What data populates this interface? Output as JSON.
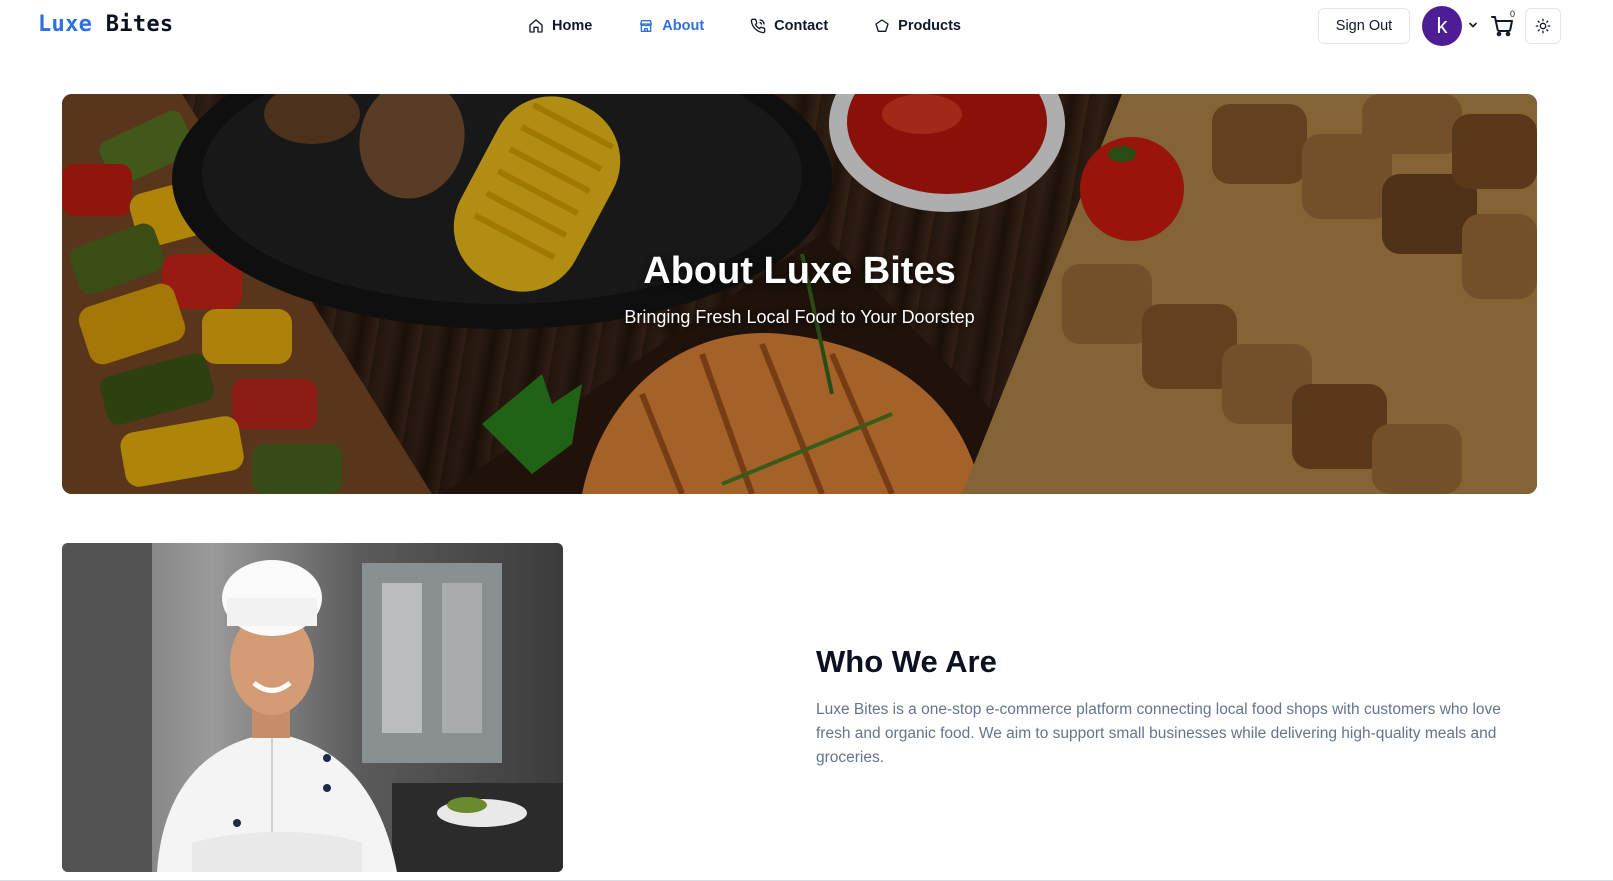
{
  "brand": {
    "part1": "Luxe",
    "part2": "Bites",
    "accent_color": "#2f6fe0"
  },
  "nav": {
    "items": [
      {
        "label": "Home",
        "icon": "home-icon",
        "active": false
      },
      {
        "label": "About",
        "icon": "store-icon",
        "active": true
      },
      {
        "label": "Contact",
        "icon": "phone-icon",
        "active": false
      },
      {
        "label": "Products",
        "icon": "package-icon",
        "active": false
      }
    ]
  },
  "header": {
    "sign_out_label": "Sign Out",
    "avatar_initial": "k",
    "avatar_color": "#4c1d95",
    "cart_count": "0"
  },
  "hero": {
    "title": "About Luxe Bites",
    "subtitle": "Bringing Fresh Local Food to Your Doorstep"
  },
  "who": {
    "title": "Who We Are",
    "text": "Luxe Bites is a one-stop e-commerce platform connecting local food shops with customers who love fresh and organic food. We aim to support small businesses while delivering high-quality meals and groceries."
  }
}
